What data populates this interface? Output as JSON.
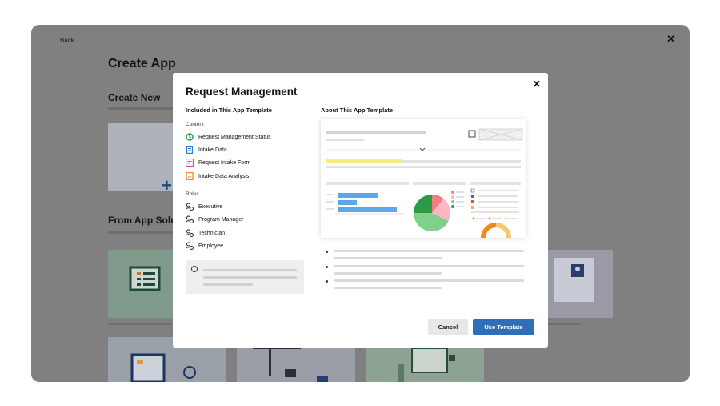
{
  "background": {
    "back_label": "Back",
    "close_symbol": "✕",
    "page_title": "Create App",
    "create_new_label": "Create New",
    "from_app_label": "From App Solu",
    "plus_symbol": "+"
  },
  "modal": {
    "title": "Request Management",
    "close_symbol": "✕",
    "included_heading": "Included in This App Template",
    "about_heading": "About This App Template",
    "content_label": "Content",
    "content_items": [
      {
        "label": "Request Management Status",
        "icon": "status-dashboard-icon",
        "color": "#2e9a45"
      },
      {
        "label": "Intake Data",
        "icon": "sheet-icon",
        "color": "#2f7ed6"
      },
      {
        "label": "Request Intake Form",
        "icon": "form-icon",
        "color": "#d24fb4"
      },
      {
        "label": "Intake Data Analysis",
        "icon": "report-icon",
        "color": "#ef8a1e"
      }
    ],
    "roles_label": "Roles",
    "roles": [
      {
        "label": "Executive",
        "icon": "role-icon"
      },
      {
        "label": "Program Manager",
        "icon": "role-icon"
      },
      {
        "label": "Technician",
        "icon": "role-icon"
      },
      {
        "label": "Employee",
        "icon": "role-icon"
      }
    ],
    "info_icon": "info-icon",
    "cancel_label": "Cancel",
    "use_template_label": "Use Template"
  },
  "colors": {
    "accent": "#2f6fba",
    "overlay": "#808080"
  }
}
